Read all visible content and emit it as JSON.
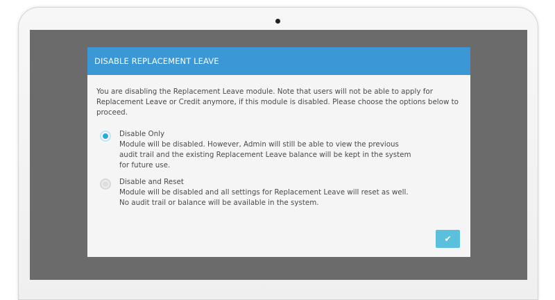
{
  "modal": {
    "title": "DISABLE REPLACEMENT LEAVE",
    "intro": "You are disabling the Replacement Leave module. Note that users will not be able to apply for Replacement Leave or Credit anymore, if this module is disabled. Please choose the options below to proceed.",
    "options": [
      {
        "label": "Disable Only",
        "description": "Module will be disabled. However, Admin will still be able to view the previous audit trail and the existing Replacement Leave balance will be kept in the system for future use.",
        "selected": true
      },
      {
        "label": "Disable and Reset",
        "description": "Module will be disabled and all settings for Replacement Leave will reset as well. No audit trail or balance will be available in the system.",
        "selected": false
      }
    ],
    "confirm_icon": "checkmark-icon",
    "confirm_glyph": "✔"
  },
  "colors": {
    "header": "#3b97d5",
    "overlay": "#6b6b6b",
    "confirm_button": "#5bc0de",
    "radio_selected": "#2ea8e1"
  }
}
